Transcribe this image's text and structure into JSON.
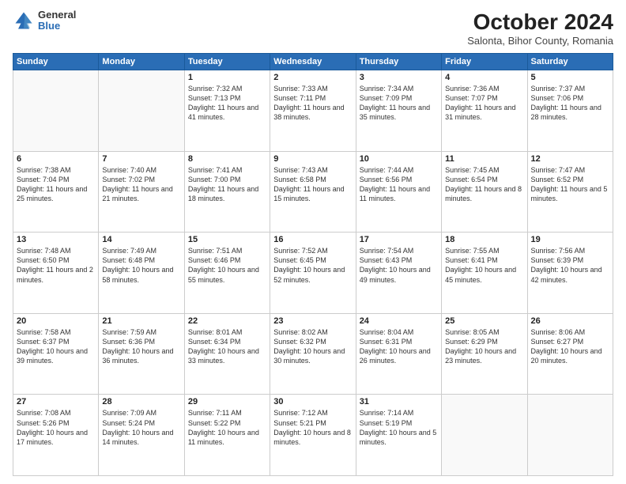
{
  "header": {
    "logo_general": "General",
    "logo_blue": "Blue",
    "title": "October 2024",
    "location": "Salonta, Bihor County, Romania"
  },
  "weekdays": [
    "Sunday",
    "Monday",
    "Tuesday",
    "Wednesday",
    "Thursday",
    "Friday",
    "Saturday"
  ],
  "weeks": [
    [
      {
        "day": "",
        "info": ""
      },
      {
        "day": "",
        "info": ""
      },
      {
        "day": "1",
        "info": "Sunrise: 7:32 AM\nSunset: 7:13 PM\nDaylight: 11 hours and 41 minutes."
      },
      {
        "day": "2",
        "info": "Sunrise: 7:33 AM\nSunset: 7:11 PM\nDaylight: 11 hours and 38 minutes."
      },
      {
        "day": "3",
        "info": "Sunrise: 7:34 AM\nSunset: 7:09 PM\nDaylight: 11 hours and 35 minutes."
      },
      {
        "day": "4",
        "info": "Sunrise: 7:36 AM\nSunset: 7:07 PM\nDaylight: 11 hours and 31 minutes."
      },
      {
        "day": "5",
        "info": "Sunrise: 7:37 AM\nSunset: 7:06 PM\nDaylight: 11 hours and 28 minutes."
      }
    ],
    [
      {
        "day": "6",
        "info": "Sunrise: 7:38 AM\nSunset: 7:04 PM\nDaylight: 11 hours and 25 minutes."
      },
      {
        "day": "7",
        "info": "Sunrise: 7:40 AM\nSunset: 7:02 PM\nDaylight: 11 hours and 21 minutes."
      },
      {
        "day": "8",
        "info": "Sunrise: 7:41 AM\nSunset: 7:00 PM\nDaylight: 11 hours and 18 minutes."
      },
      {
        "day": "9",
        "info": "Sunrise: 7:43 AM\nSunset: 6:58 PM\nDaylight: 11 hours and 15 minutes."
      },
      {
        "day": "10",
        "info": "Sunrise: 7:44 AM\nSunset: 6:56 PM\nDaylight: 11 hours and 11 minutes."
      },
      {
        "day": "11",
        "info": "Sunrise: 7:45 AM\nSunset: 6:54 PM\nDaylight: 11 hours and 8 minutes."
      },
      {
        "day": "12",
        "info": "Sunrise: 7:47 AM\nSunset: 6:52 PM\nDaylight: 11 hours and 5 minutes."
      }
    ],
    [
      {
        "day": "13",
        "info": "Sunrise: 7:48 AM\nSunset: 6:50 PM\nDaylight: 11 hours and 2 minutes."
      },
      {
        "day": "14",
        "info": "Sunrise: 7:49 AM\nSunset: 6:48 PM\nDaylight: 10 hours and 58 minutes."
      },
      {
        "day": "15",
        "info": "Sunrise: 7:51 AM\nSunset: 6:46 PM\nDaylight: 10 hours and 55 minutes."
      },
      {
        "day": "16",
        "info": "Sunrise: 7:52 AM\nSunset: 6:45 PM\nDaylight: 10 hours and 52 minutes."
      },
      {
        "day": "17",
        "info": "Sunrise: 7:54 AM\nSunset: 6:43 PM\nDaylight: 10 hours and 49 minutes."
      },
      {
        "day": "18",
        "info": "Sunrise: 7:55 AM\nSunset: 6:41 PM\nDaylight: 10 hours and 45 minutes."
      },
      {
        "day": "19",
        "info": "Sunrise: 7:56 AM\nSunset: 6:39 PM\nDaylight: 10 hours and 42 minutes."
      }
    ],
    [
      {
        "day": "20",
        "info": "Sunrise: 7:58 AM\nSunset: 6:37 PM\nDaylight: 10 hours and 39 minutes."
      },
      {
        "day": "21",
        "info": "Sunrise: 7:59 AM\nSunset: 6:36 PM\nDaylight: 10 hours and 36 minutes."
      },
      {
        "day": "22",
        "info": "Sunrise: 8:01 AM\nSunset: 6:34 PM\nDaylight: 10 hours and 33 minutes."
      },
      {
        "day": "23",
        "info": "Sunrise: 8:02 AM\nSunset: 6:32 PM\nDaylight: 10 hours and 30 minutes."
      },
      {
        "day": "24",
        "info": "Sunrise: 8:04 AM\nSunset: 6:31 PM\nDaylight: 10 hours and 26 minutes."
      },
      {
        "day": "25",
        "info": "Sunrise: 8:05 AM\nSunset: 6:29 PM\nDaylight: 10 hours and 23 minutes."
      },
      {
        "day": "26",
        "info": "Sunrise: 8:06 AM\nSunset: 6:27 PM\nDaylight: 10 hours and 20 minutes."
      }
    ],
    [
      {
        "day": "27",
        "info": "Sunrise: 7:08 AM\nSunset: 5:26 PM\nDaylight: 10 hours and 17 minutes."
      },
      {
        "day": "28",
        "info": "Sunrise: 7:09 AM\nSunset: 5:24 PM\nDaylight: 10 hours and 14 minutes."
      },
      {
        "day": "29",
        "info": "Sunrise: 7:11 AM\nSunset: 5:22 PM\nDaylight: 10 hours and 11 minutes."
      },
      {
        "day": "30",
        "info": "Sunrise: 7:12 AM\nSunset: 5:21 PM\nDaylight: 10 hours and 8 minutes."
      },
      {
        "day": "31",
        "info": "Sunrise: 7:14 AM\nSunset: 5:19 PM\nDaylight: 10 hours and 5 minutes."
      },
      {
        "day": "",
        "info": ""
      },
      {
        "day": "",
        "info": ""
      }
    ]
  ]
}
